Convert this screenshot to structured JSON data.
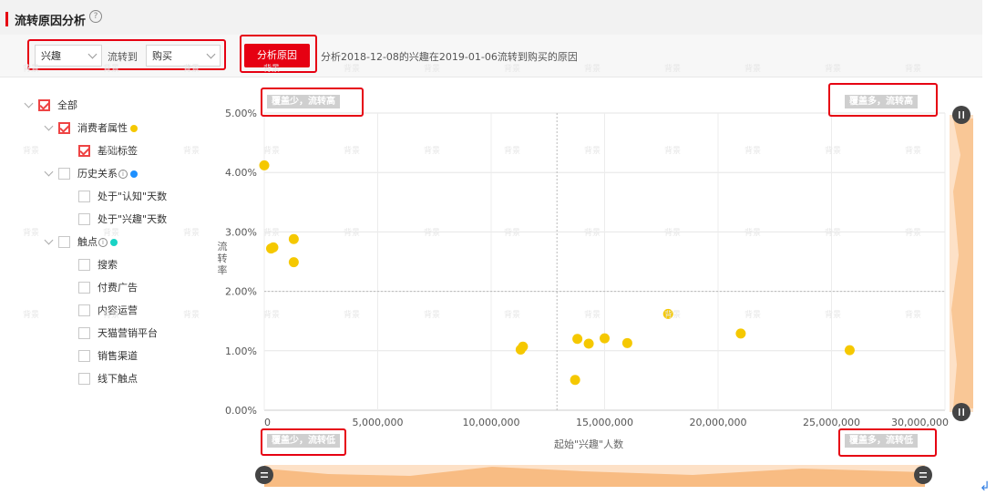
{
  "header": {
    "title": "流转原因分析",
    "help_icon": "question-circle-icon"
  },
  "controls": {
    "from_select": {
      "value": "兴趣"
    },
    "to_label": "流转到",
    "to_select": {
      "value": "购买"
    },
    "analyze_button": "分析原因",
    "description": "分析2018-12-08的兴趣在2019-01-06流转到购买的原因"
  },
  "tree": [
    {
      "label": "全部",
      "checked": true,
      "level": 0,
      "expandable": true
    },
    {
      "label": "消费者属性",
      "checked": true,
      "level": 1,
      "expandable": true,
      "dot": "#f5c800"
    },
    {
      "label": "基础标签",
      "checked": true,
      "level": 2
    },
    {
      "label": "历史关系",
      "checked": false,
      "level": 1,
      "expandable": true,
      "info": "i",
      "dot": "#1e90ff"
    },
    {
      "label": "处于\"认知\"天数",
      "checked": false,
      "level": 2
    },
    {
      "label": "处于\"兴趣\"天数",
      "checked": false,
      "level": 2
    },
    {
      "label": "触点",
      "checked": false,
      "level": 1,
      "expandable": true,
      "info": "i",
      "dot": "#19d3c5"
    },
    {
      "label": "搜索",
      "checked": false,
      "level": 2
    },
    {
      "label": "付费广告",
      "checked": false,
      "level": 2
    },
    {
      "label": "内容运营",
      "checked": false,
      "level": 2
    },
    {
      "label": "天猫营销平台",
      "checked": false,
      "level": 2
    },
    {
      "label": "销售渠道",
      "checked": false,
      "level": 2
    },
    {
      "label": "线下触点",
      "checked": false,
      "level": 2
    }
  ],
  "quadrants": {
    "top_left": "覆盖少，流转高",
    "top_right": "覆盖多，流转高",
    "bottom_left": "覆盖少，流转低",
    "bottom_right": "覆盖多，流转低"
  },
  "watermark": "背景",
  "chart_data": {
    "type": "scatter",
    "ylabel": "流转率",
    "xlabel": "起始\"兴趣\"人数",
    "xlim": [
      0,
      30000000
    ],
    "ylim": [
      0,
      5
    ],
    "x_ticks": [
      0,
      5000000,
      10000000,
      15000000,
      20000000,
      25000000,
      30000000
    ],
    "x_tick_labels": [
      "0",
      "5,000,000",
      "10,000,000",
      "15,000,000",
      "20,000,000",
      "25,000,000",
      "30,000,000"
    ],
    "y_ticks": [
      0,
      1,
      2,
      3,
      4,
      5
    ],
    "y_tick_labels": [
      "0.00%",
      "1.00%",
      "2.00%",
      "3.00%",
      "4.00%",
      "5.00%"
    ],
    "x_split": 12900000,
    "y_split": 2.0,
    "color": "#f5c800",
    "points": [
      {
        "x": 0,
        "y": 4.12
      },
      {
        "x": 300000,
        "y": 2.72
      },
      {
        "x": 400000,
        "y": 2.74
      },
      {
        "x": 1300000,
        "y": 2.88
      },
      {
        "x": 1300000,
        "y": 2.49
      },
      {
        "x": 11300000,
        "y": 1.02
      },
      {
        "x": 11400000,
        "y": 1.07
      },
      {
        "x": 13700000,
        "y": 0.51
      },
      {
        "x": 13800000,
        "y": 1.2
      },
      {
        "x": 14300000,
        "y": 1.12
      },
      {
        "x": 15000000,
        "y": 1.21
      },
      {
        "x": 16000000,
        "y": 1.13
      },
      {
        "x": 17800000,
        "y": 1.62
      },
      {
        "x": 21000000,
        "y": 1.29
      },
      {
        "x": 25800000,
        "y": 1.01
      }
    ]
  }
}
